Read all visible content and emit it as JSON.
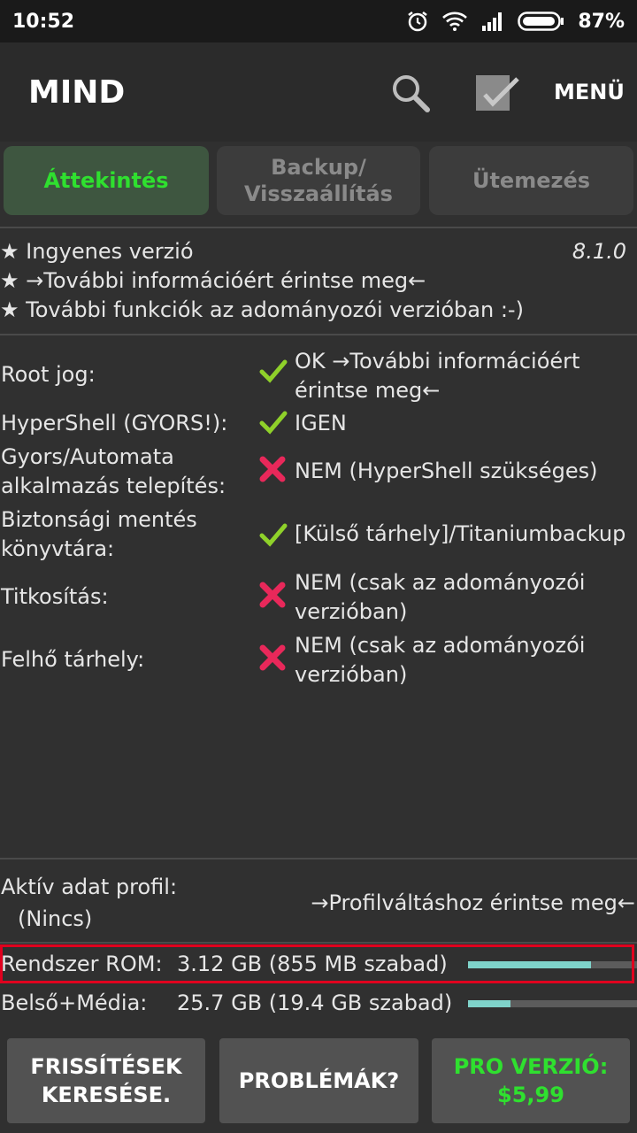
{
  "statusbar": {
    "time": "10:52",
    "battery": "87%"
  },
  "appbar": {
    "title": "MIND",
    "menu_label": "MENÜ"
  },
  "tabs": [
    {
      "label": "Áttekintés",
      "active": true
    },
    {
      "label_line1": "Backup/",
      "label_line2": "Visszaállítás",
      "active": false
    },
    {
      "label": "Ütemezés",
      "active": false
    }
  ],
  "info": {
    "line1": "★ Ingyenes verzió",
    "version": "8.1.0",
    "line2": "★  →További információért érintse meg←",
    "line3": "★ További funkciók az adományozói verzióban :-)"
  },
  "status_rows": [
    {
      "label": "Root jog:",
      "ok": true,
      "value": "OK →További információért érintse meg←"
    },
    {
      "label": "HyperShell (GYORS!):",
      "ok": true,
      "value": "IGEN"
    },
    {
      "label": "Gyors/Automata alkalmazás telepítés:",
      "ok": false,
      "value": "NEM (HyperShell szükséges)"
    },
    {
      "label": "Biztonsági mentés könyvtára:",
      "ok": true,
      "value": "[Külső tárhely]/Titaniumbackup"
    },
    {
      "label": "Titkosítás:",
      "ok": false,
      "value": "NEM (csak az adományozói verzióban)"
    },
    {
      "label": "Felhő tárhely:",
      "ok": false,
      "value": "NEM (csak az adományozói verzióban)"
    }
  ],
  "profile": {
    "label": "Aktív adat profil:",
    "value": "(Nincs)",
    "action": "→Profilváltáshoz érintse meg←"
  },
  "storage": [
    {
      "label": "Rendszer ROM:",
      "value": "3.12 GB (855 MB szabad)",
      "used_fraction": 0.73
    },
    {
      "label": "Belső+Média:",
      "value": "25.7 GB (19.4 GB szabad)",
      "used_fraction": 0.25
    }
  ],
  "buttons": {
    "updates_line1": "FRISSÍTÉSEK",
    "updates_line2": "KERESÉSE.",
    "problems": "PROBLÉMÁK?",
    "pro_line1": "PRO VERZIÓ:",
    "pro_line2": "$5,99"
  },
  "colors": {
    "accent_green": "#2fe02f",
    "ok_check": "#8fd12a",
    "error_cross": "#e8285a",
    "bar_fill": "#7fd3ca",
    "highlight_border": "#e0001e"
  },
  "icons": [
    "alarm-icon",
    "wifi-icon",
    "signal-icon",
    "battery-icon",
    "search-icon",
    "check-all-icon",
    "checkmark-icon",
    "cross-icon"
  ]
}
